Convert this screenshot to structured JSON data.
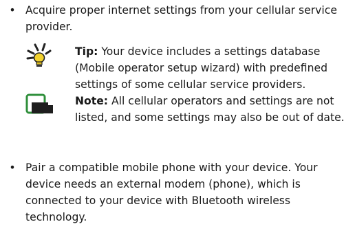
{
  "content": {
    "bullet_1": {
      "marker": "•",
      "text": "Acquire proper internet settings from your cellular service provider."
    },
    "tip": {
      "icon": "lightbulb-icon",
      "label": "Tip:",
      "text": " Your device includes a settings database (Mobile operator setup wizard) with predefined settings of some cellular service providers."
    },
    "note": {
      "icon": "note-hand-icon",
      "label": "Note:",
      "text": " All cellular operators and settings are not listed, and some settings may also be out of date."
    },
    "bullet_2": {
      "marker": "•",
      "text": "Pair a compatible mobile phone with your device. Your device needs an external modem (phone), which is connected to your device with Bluetooth wireless technology."
    }
  },
  "colors": {
    "text": "#1a1a1a",
    "icon_yellow": "#f2d22e",
    "icon_dark": "#222222",
    "note_frame": "#2f8f3b"
  }
}
